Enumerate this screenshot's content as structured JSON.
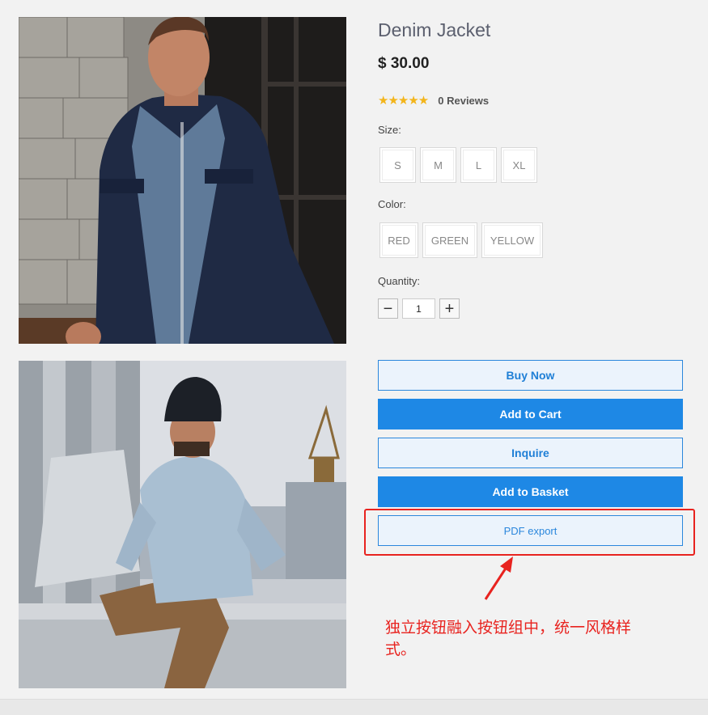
{
  "product": {
    "title": "Denim Jacket",
    "price": "$ 30.00",
    "stars": "★★★★★",
    "reviews": "0 Reviews",
    "size_label": "Size:",
    "sizes": [
      "S",
      "M",
      "L",
      "XL"
    ],
    "color_label": "Color:",
    "colors": [
      "RED",
      "GREEN",
      "YELLOW"
    ],
    "quantity_label": "Quantity:",
    "quantity": "1",
    "minus": "−",
    "plus": "+"
  },
  "buttons": {
    "buy_now": "Buy Now",
    "add_to_cart": "Add to Cart",
    "inquire": "Inquire",
    "add_to_basket": "Add to Basket",
    "pdf_export": "PDF export"
  },
  "annotation": {
    "text": "独立按钮融入按钮组中，统一风格样式。",
    "color": "#e8231f"
  },
  "colors": {
    "accent": "#1e88e5",
    "star": "#f3b51b"
  }
}
